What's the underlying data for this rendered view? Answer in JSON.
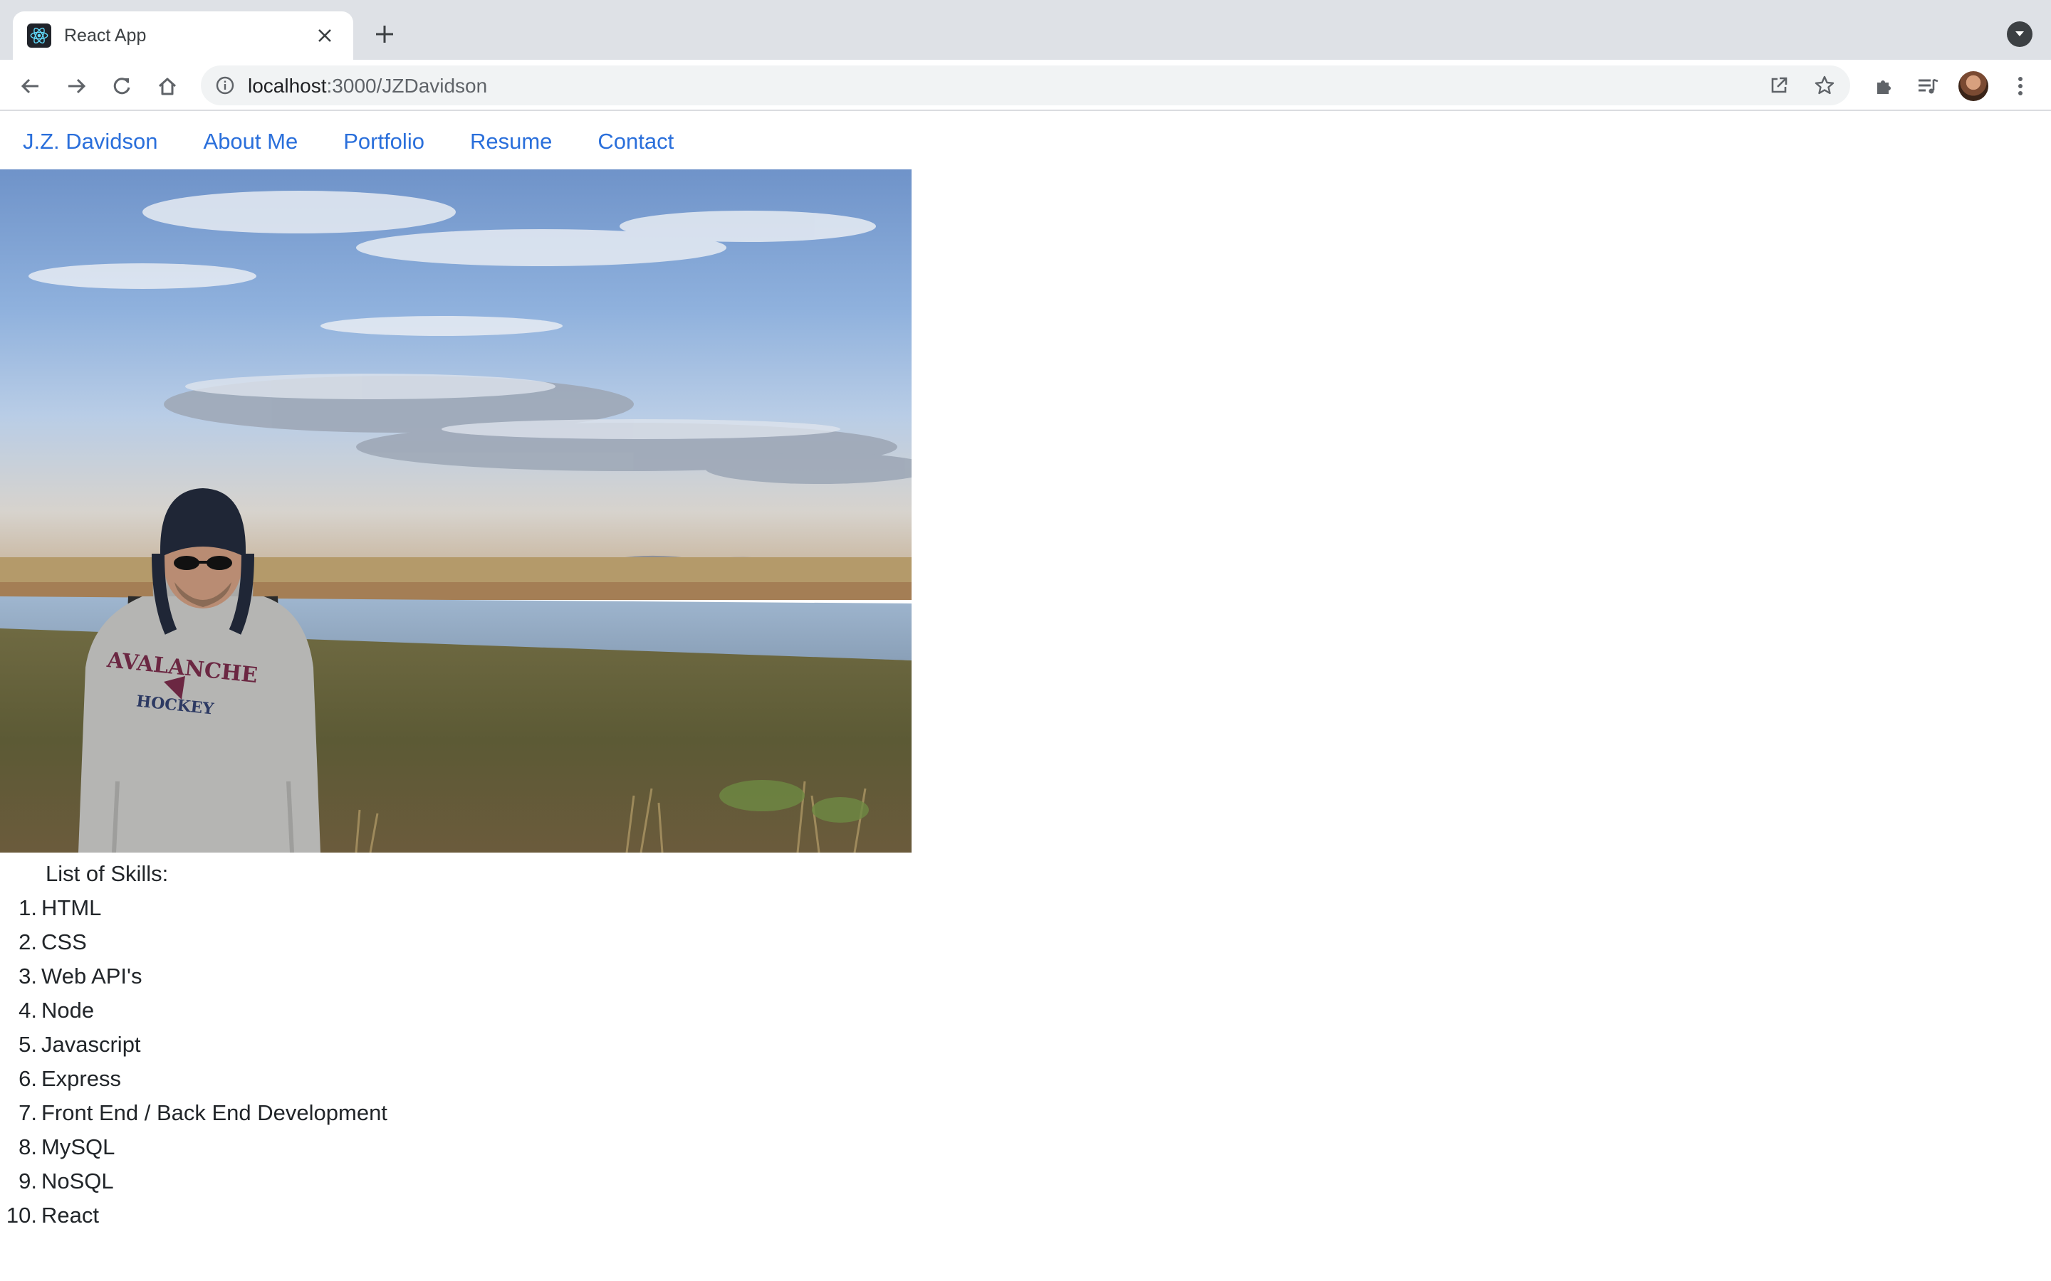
{
  "browser": {
    "tab": {
      "title": "React App",
      "favicon": "react-logo-icon"
    },
    "address_bar": {
      "host": "localhost",
      "path": ":3000/JZDavidson"
    }
  },
  "nav": {
    "brand": "J.Z. Davidson",
    "links": [
      "About Me",
      "Portfolio",
      "Resume",
      "Contact"
    ]
  },
  "hero": {
    "image": "person-in-hoodie-standing-by-river-under-cloudy-sky",
    "hoodie_text": [
      "AVALANCHE",
      "HOCKEY"
    ]
  },
  "skills": {
    "heading": "List of Skills:",
    "items": [
      {
        "num": "1.",
        "label": "HTML"
      },
      {
        "num": "2.",
        "label": "CSS"
      },
      {
        "num": "3.",
        "label": "Web API's"
      },
      {
        "num": "4.",
        "label": "Node"
      },
      {
        "num": "5.",
        "label": "Javascript"
      },
      {
        "num": "6.",
        "label": "Express"
      },
      {
        "num": "7.",
        "label": "Front End / Back End Development"
      },
      {
        "num": "8.",
        "label": "MySQL"
      },
      {
        "num": "9.",
        "label": "NoSQL"
      },
      {
        "num": "10.",
        "label": "React"
      }
    ]
  },
  "colors": {
    "link": "#2a6fdb",
    "tabstrip": "#dee1e6",
    "omnibox": "#f1f3f4"
  }
}
